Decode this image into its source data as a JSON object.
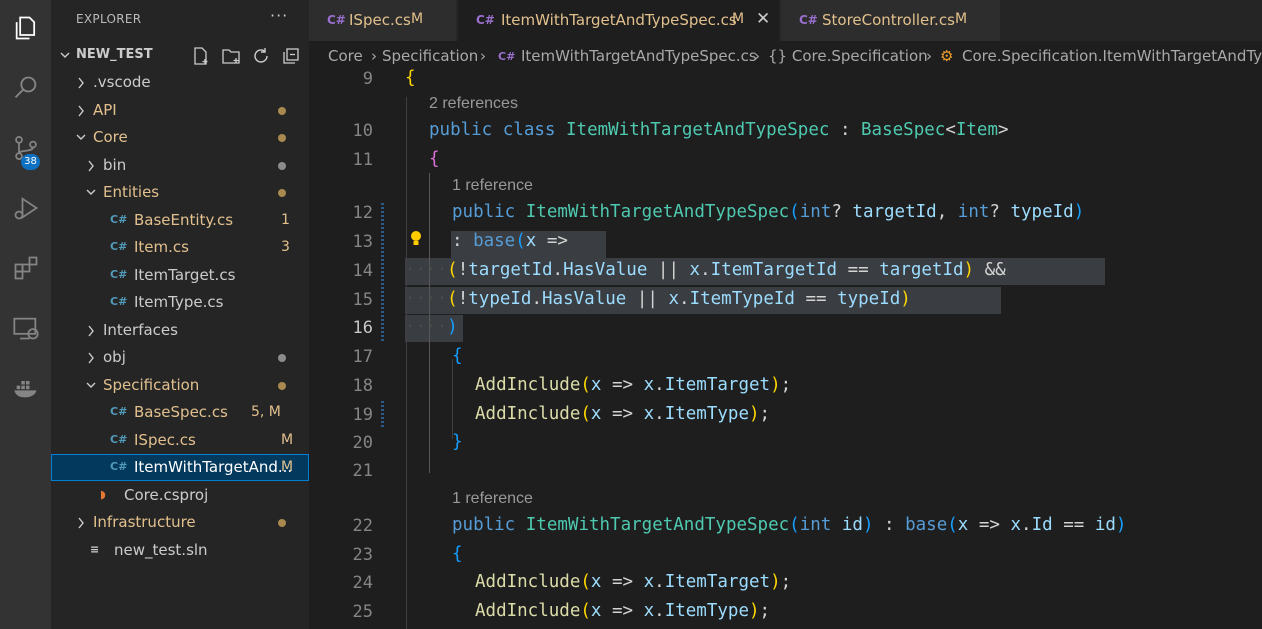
{
  "activity_bar": {
    "items": [
      {
        "icon": "explorer-icon"
      },
      {
        "icon": "search-icon"
      },
      {
        "icon": "source-control-icon",
        "badge": "38"
      },
      {
        "icon": "run-debug-icon"
      },
      {
        "icon": "extensions-icon"
      },
      {
        "icon": "remote-explorer-icon"
      },
      {
        "icon": "docker-icon"
      }
    ]
  },
  "sidebar": {
    "title": "EXPLORER",
    "more": "···",
    "folder": "NEW_TEST",
    "tree": [
      {
        "label": ".vscode",
        "type": "folder",
        "state": "collapsed",
        "depth": 0,
        "status": "",
        "dot": false
      },
      {
        "label": "API",
        "type": "folder",
        "state": "collapsed",
        "depth": 0,
        "status": "",
        "dot": true,
        "modified": true
      },
      {
        "label": "Core",
        "type": "folder",
        "state": "expanded",
        "depth": 0,
        "status": "",
        "dot": true,
        "modified": true
      },
      {
        "label": "bin",
        "type": "folder",
        "state": "collapsed",
        "depth": 1,
        "status": "",
        "dot": true,
        "modified": false
      },
      {
        "label": "Entities",
        "type": "folder",
        "state": "expanded",
        "depth": 1,
        "status": "",
        "dot": true,
        "modified": true
      },
      {
        "label": "BaseEntity.cs",
        "type": "cs",
        "depth": 2,
        "status": "1",
        "modified": true
      },
      {
        "label": "Item.cs",
        "type": "cs",
        "depth": 2,
        "status": "3",
        "modified": true
      },
      {
        "label": "ItemTarget.cs",
        "type": "cs",
        "depth": 2,
        "status": "",
        "modified": false
      },
      {
        "label": "ItemType.cs",
        "type": "cs",
        "depth": 2,
        "status": "",
        "modified": false
      },
      {
        "label": "Interfaces",
        "type": "folder",
        "state": "collapsed",
        "depth": 1,
        "status": "",
        "dot": false
      },
      {
        "label": "obj",
        "type": "folder",
        "state": "collapsed",
        "depth": 1,
        "status": "",
        "dot": true,
        "modified": false
      },
      {
        "label": "Specification",
        "type": "folder",
        "state": "expanded",
        "depth": 1,
        "status": "",
        "dot": true,
        "modified": true
      },
      {
        "label": "BaseSpec.cs",
        "type": "cs",
        "depth": 2,
        "status": "5, M",
        "modified": true
      },
      {
        "label": "ISpec.cs",
        "type": "cs",
        "depth": 2,
        "status": "M",
        "modified": true
      },
      {
        "label": "ItemWithTargetAnd...",
        "type": "cs",
        "depth": 2,
        "status": "M",
        "modified": false,
        "selected": true
      },
      {
        "label": "Core.csproj",
        "type": "rss",
        "depth": 1,
        "status": "",
        "modified": false
      },
      {
        "label": "Infrastructure",
        "type": "folder",
        "state": "collapsed",
        "depth": 0,
        "status": "",
        "dot": true,
        "modified": true
      },
      {
        "label": "new_test.sln",
        "type": "sln",
        "depth": 0,
        "status": "",
        "modified": false
      }
    ]
  },
  "tabs": [
    {
      "label": "ISpec.cs",
      "status": "M",
      "active": false
    },
    {
      "label": "ItemWithTargetAndTypeSpec.cs",
      "status": "M",
      "active": true,
      "close": "✕"
    },
    {
      "label": "StoreController.cs",
      "status": "M",
      "active": false
    }
  ],
  "breadcrumb": {
    "p1": "Core",
    "p2": "Specification",
    "p3": "ItemWithTargetAndTypeSpec.cs",
    "p4": "{} Core.Specification",
    "p5": "Core.Specification.ItemWithTargetAndTypeSpec"
  },
  "editor": {
    "line_numbers": [
      "9",
      "10",
      "11",
      "12",
      "13",
      "14",
      "15",
      "16",
      "17",
      "18",
      "19",
      "20",
      "21",
      "22",
      "23",
      "24",
      "25"
    ],
    "current_line": "16",
    "lens_class": "2 references",
    "lens_ctor1": "1 reference",
    "lens_ctor2": "1 reference",
    "code": {
      "l9_brace": "{",
      "l10_public": "public",
      "l10_class": "class",
      "l10_name": "ItemWithTargetAndTypeSpec",
      "l10_colon": " : ",
      "l10_base": "BaseSpec",
      "l10_lt": "<",
      "l10_item": "Item",
      "l10_gt": ">",
      "l11_brace": "{",
      "l12_public": "public",
      "l12_name": "ItemWithTargetAndTypeSpec",
      "l12_paren": "(",
      "l12_int1": "int",
      "l12_q1": "? ",
      "l12_p1": "targetId",
      "l12_comma": ", ",
      "l12_int2": "int",
      "l12_q2": "? ",
      "l12_p2": "typeId",
      "l12_close": ")",
      "l13_colon": ": ",
      "l13_base": "base",
      "l13_paren": "(",
      "l13_x": "x",
      "l13_arrow": " => ",
      "l14_ws": "····",
      "l14_open": "(",
      "l14_not": "!",
      "l14_tid": "targetId",
      "l14_dot": ".",
      "l14_hv": "HasValue",
      "l14_or": " || ",
      "l14_x": "x",
      "l14_dot2": ".",
      "l14_itid": "ItemTargetId",
      "l14_eq": " == ",
      "l14_tid2": "targetId",
      "l14_close": ")",
      "l14_and": " &&",
      "l15_ws": "····",
      "l15_open": "(",
      "l15_not": "!",
      "l15_tid": "typeId",
      "l15_dot": ".",
      "l15_hv": "HasValue",
      "l15_or": " || ",
      "l15_x": "x",
      "l15_dot2": ".",
      "l15_itid": "ItemTypeId",
      "l15_eq": " == ",
      "l15_tid2": "typeId",
      "l15_close": ")",
      "l16_ws": "····",
      "l16_close": ")",
      "l17_brace": "{",
      "l18_fn": "AddInclude",
      "l18_open": "(",
      "l18_x": "x",
      "l18_arrow": " => ",
      "l18_x2": "x",
      "l18_dot": ".",
      "l18_prop": "ItemTarget",
      "l18_close": ")",
      "l18_semi": ";",
      "l19_fn": "AddInclude",
      "l19_open": "(",
      "l19_x": "x",
      "l19_arrow": " => ",
      "l19_x2": "x",
      "l19_dot": ".",
      "l19_prop": "ItemType",
      "l19_close": ")",
      "l19_semi": ";",
      "l20_brace": "}",
      "l22_public": "public",
      "l22_name": "ItemWithTargetAndTypeSpec",
      "l22_open": "(",
      "l22_int": "int",
      "l22_id": " id",
      "l22_close": ")",
      "l22_colon": " : ",
      "l22_base": "base",
      "l22_open2": "(",
      "l22_x": "x",
      "l22_arrow": " => ",
      "l22_x2": "x",
      "l22_dot": ".",
      "l22_idp": "Id",
      "l22_eq": " == ",
      "l22_id2": "id",
      "l22_close2": ")",
      "l23_brace": "{",
      "l24_fn": "AddInclude",
      "l24_open": "(",
      "l24_x": "x",
      "l24_arrow": " => ",
      "l24_x2": "x",
      "l24_dot": ".",
      "l24_prop": "ItemTarget",
      "l24_close": ")",
      "l24_semi": ";",
      "l25_fn": "AddInclude",
      "l25_open": "(",
      "l25_x": "x",
      "l25_arrow": " => ",
      "l25_x2": "x",
      "l25_dot": ".",
      "l25_prop": "ItemType",
      "l25_close": ")",
      "l25_semi": ";"
    }
  },
  "colors": {
    "modified": "#e2c08d",
    "selection": "#3a3d41",
    "badge": "#0e70c0",
    "keyword": "#569cd6",
    "type": "#4ec9b0"
  }
}
